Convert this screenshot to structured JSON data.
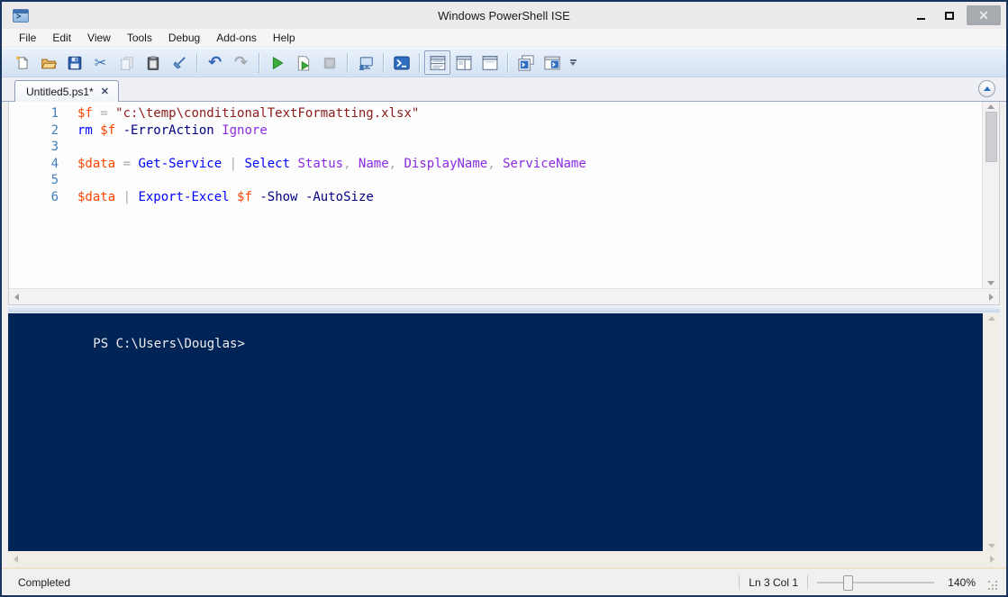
{
  "window": {
    "title": "Windows PowerShell ISE",
    "controls": {
      "minimize": "minimize",
      "maximize": "maximize",
      "close": "✕"
    }
  },
  "menu": {
    "items": [
      "File",
      "Edit",
      "View",
      "Tools",
      "Debug",
      "Add-ons",
      "Help"
    ]
  },
  "toolbar": {
    "groups": [
      [
        "new-script",
        "open-script",
        "save-script",
        "cut",
        "copy",
        "paste",
        "clear-console-pane"
      ],
      [
        "undo",
        "redo"
      ],
      [
        "run-script",
        "run-selection",
        "stop-operation"
      ],
      [
        "new-remote-powershell-tab"
      ],
      [
        "start-powershell"
      ],
      [
        "show-script-pane-top",
        "show-script-pane-right",
        "show-script-pane-maximized"
      ],
      [
        "new-powershell-tab",
        "show-powershell-window"
      ]
    ],
    "selected": "show-script-pane-top",
    "disabled": [
      "copy",
      "redo",
      "stop-operation"
    ],
    "overflow": "toolbar-overflow"
  },
  "tabstrip": {
    "tabs": [
      {
        "label": "Untitled5.ps1*",
        "close_glyph": "✕"
      }
    ],
    "collapse_button": "chevron-up"
  },
  "editor": {
    "syntax_colors": {
      "variable": "#FF4500",
      "operator": "#A9A9A9",
      "string": "#8B1A1A",
      "command": "#0000FF",
      "parameter": "#000080",
      "argument": "#8A2BE2",
      "default": "#000000",
      "line_number": "#437FB8"
    },
    "lines": [
      {
        "n": 1,
        "tokens": [
          [
            "variable",
            "$f"
          ],
          [
            "operator",
            " = "
          ],
          [
            "string",
            "\"c:\\temp\\conditionalTextFormatting.xlsx\""
          ]
        ]
      },
      {
        "n": 2,
        "tokens": [
          [
            "command",
            "rm"
          ],
          [
            "default",
            " "
          ],
          [
            "variable",
            "$f"
          ],
          [
            "default",
            " "
          ],
          [
            "parameter",
            "-ErrorAction"
          ],
          [
            "default",
            " "
          ],
          [
            "argument",
            "Ignore"
          ]
        ]
      },
      {
        "n": 3,
        "tokens": []
      },
      {
        "n": 4,
        "tokens": [
          [
            "variable",
            "$data"
          ],
          [
            "operator",
            " = "
          ],
          [
            "command",
            "Get-Service"
          ],
          [
            "operator",
            " | "
          ],
          [
            "command",
            "Select"
          ],
          [
            "default",
            " "
          ],
          [
            "argument",
            "Status"
          ],
          [
            "operator",
            ", "
          ],
          [
            "argument",
            "Name"
          ],
          [
            "operator",
            ", "
          ],
          [
            "argument",
            "DisplayName"
          ],
          [
            "operator",
            ", "
          ],
          [
            "argument",
            "ServiceName"
          ]
        ]
      },
      {
        "n": 5,
        "tokens": []
      },
      {
        "n": 6,
        "tokens": [
          [
            "variable",
            "$data"
          ],
          [
            "operator",
            " | "
          ],
          [
            "command",
            "Export-Excel"
          ],
          [
            "default",
            " "
          ],
          [
            "variable",
            "$f"
          ],
          [
            "default",
            " "
          ],
          [
            "parameter",
            "-Show"
          ],
          [
            "default",
            " "
          ],
          [
            "parameter",
            "-AutoSize"
          ]
        ]
      }
    ]
  },
  "console": {
    "prompt": "PS C:\\Users\\Douglas>",
    "background": "#012456",
    "text_color": "#EEEDF0"
  },
  "statusbar": {
    "status": "Completed",
    "line_col": "Ln 3 Col 1",
    "zoom_percent": "140%",
    "zoom_slider_position": 0.27
  }
}
